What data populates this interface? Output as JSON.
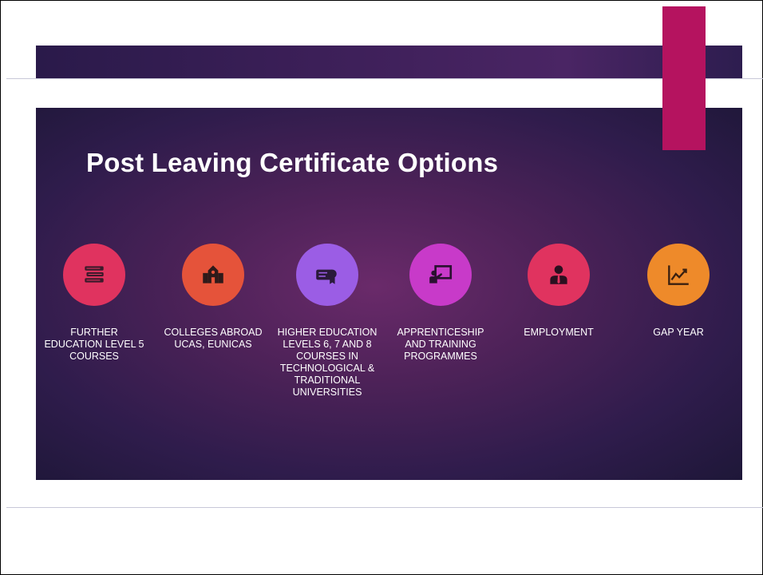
{
  "slide": {
    "title": "Post Leaving Certificate Options",
    "options": [
      {
        "label": "FURTHER EDUCATION LEVEL 5 COURSES",
        "icon": "books-icon",
        "color": "#e0335f"
      },
      {
        "label": "COLLEGES ABROAD UCAS, EUNICAS",
        "icon": "school-building-icon",
        "color": "#e5533a"
      },
      {
        "label": "HIGHER EDUCATION LEVELS 6, 7 AND 8 COURSES IN TECHNOLOGICAL & TRADITIONAL UNIVERSITIES",
        "icon": "diploma-icon",
        "color": "#9b5de5"
      },
      {
        "label": "APPRENTICESHIP AND TRAINING PROGRAMMES",
        "icon": "teacher-board-icon",
        "color": "#c83ac9"
      },
      {
        "label": "EMPLOYMENT",
        "icon": "businessman-icon",
        "color": "#e0335f"
      },
      {
        "label": "GAP YEAR",
        "icon": "line-chart-icon",
        "color": "#ee8a2a"
      }
    ]
  },
  "colors": {
    "accent_bar": "#b5135f",
    "slide_background": "#4d2258"
  }
}
